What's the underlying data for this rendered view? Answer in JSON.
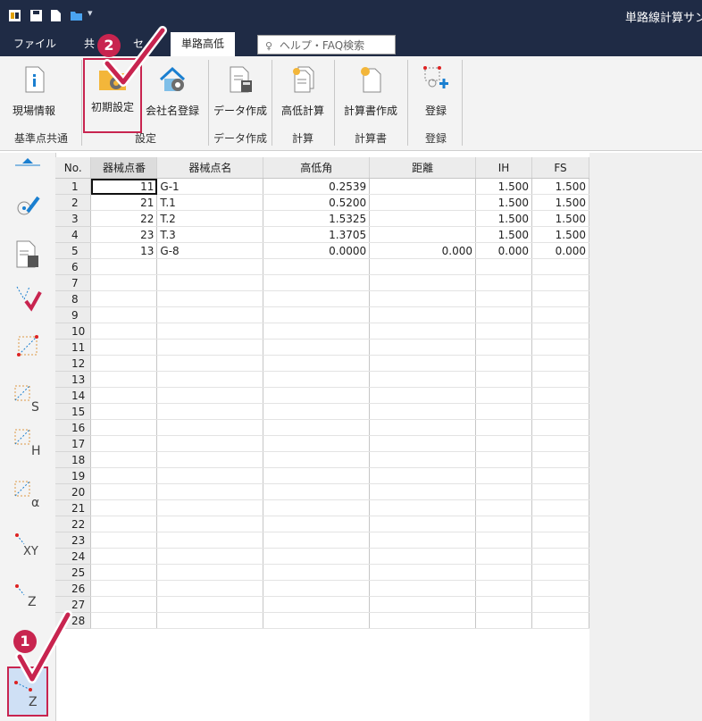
{
  "window": {
    "title": "単路線計算サン"
  },
  "ribbon_tabs": [
    "ファイル",
    "共",
    "セ",
    "単路高低"
  ],
  "help_search": {
    "placeholder": "ヘルプ・FAQ検索"
  },
  "ribbon_buttons": [
    {
      "label": "現場情報",
      "icon": "info-document-icon"
    },
    {
      "label": "初期設定",
      "icon": "folder-gear-icon"
    },
    {
      "label": "会社名登録",
      "icon": "house-gear-icon"
    },
    {
      "label": "データ作成",
      "icon": "document-calculator-icon"
    },
    {
      "label": "高低計算",
      "icon": "document-stack-icon"
    },
    {
      "label": "計算書作成",
      "icon": "document-star-icon"
    },
    {
      "label": "登録",
      "icon": "point-plus-icon"
    }
  ],
  "ribbon_groups": [
    "基準点共通",
    "設定",
    "データ作成",
    "計算",
    "計算書",
    "登録"
  ],
  "table": {
    "columns": [
      "No.",
      "器械点番",
      "器械点名",
      "高低角",
      "距離",
      "IH",
      "FS"
    ],
    "rows": [
      [
        "1",
        "11",
        "G-1",
        "0.2539",
        "",
        "1.500",
        "1.500"
      ],
      [
        "2",
        "21",
        "T.1",
        "0.5200",
        "",
        "1.500",
        "1.500"
      ],
      [
        "3",
        "22",
        "T.2",
        "1.5325",
        "",
        "1.500",
        "1.500"
      ],
      [
        "4",
        "23",
        "T.3",
        "1.3705",
        "",
        "1.500",
        "1.500"
      ],
      [
        "5",
        "13",
        "G-8",
        "0.0000",
        "0.000",
        "0.000",
        "0.000"
      ],
      [
        "6",
        "",
        "",
        "",
        "",
        "",
        ""
      ],
      [
        "7",
        "",
        "",
        "",
        "",
        "",
        ""
      ],
      [
        "8",
        "",
        "",
        "",
        "",
        "",
        ""
      ],
      [
        "9",
        "",
        "",
        "",
        "",
        "",
        ""
      ],
      [
        "10",
        "",
        "",
        "",
        "",
        "",
        ""
      ],
      [
        "11",
        "",
        "",
        "",
        "",
        "",
        ""
      ],
      [
        "12",
        "",
        "",
        "",
        "",
        "",
        ""
      ],
      [
        "13",
        "",
        "",
        "",
        "",
        "",
        ""
      ],
      [
        "14",
        "",
        "",
        "",
        "",
        "",
        ""
      ],
      [
        "15",
        "",
        "",
        "",
        "",
        "",
        ""
      ],
      [
        "16",
        "",
        "",
        "",
        "",
        "",
        ""
      ],
      [
        "17",
        "",
        "",
        "",
        "",
        "",
        ""
      ],
      [
        "18",
        "",
        "",
        "",
        "",
        "",
        ""
      ],
      [
        "19",
        "",
        "",
        "",
        "",
        "",
        ""
      ],
      [
        "20",
        "",
        "",
        "",
        "",
        "",
        ""
      ],
      [
        "21",
        "",
        "",
        "",
        "",
        "",
        ""
      ],
      [
        "22",
        "",
        "",
        "",
        "",
        "",
        ""
      ],
      [
        "23",
        "",
        "",
        "",
        "",
        "",
        ""
      ],
      [
        "24",
        "",
        "",
        "",
        "",
        "",
        ""
      ],
      [
        "25",
        "",
        "",
        "",
        "",
        "",
        ""
      ],
      [
        "26",
        "",
        "",
        "",
        "",
        "",
        ""
      ],
      [
        "27",
        "",
        "",
        "",
        "",
        "",
        ""
      ],
      [
        "28",
        "",
        "",
        "",
        "",
        "",
        ""
      ]
    ]
  },
  "sidebar_icons": [
    "collapse-arrow-icon",
    "point-pen-icon",
    "calculator-doc-icon",
    "check-chart-icon",
    "grid-points-icon",
    "grid-s-icon",
    "grid-h-icon",
    "grid-alpha-icon",
    "xy-icon",
    "z-icon",
    "xyz-z-icon"
  ],
  "callouts": [
    {
      "label": "2"
    },
    {
      "label": "1"
    }
  ],
  "colors": {
    "accent": "#c8244f",
    "titlebar": "#1f2b45"
  }
}
